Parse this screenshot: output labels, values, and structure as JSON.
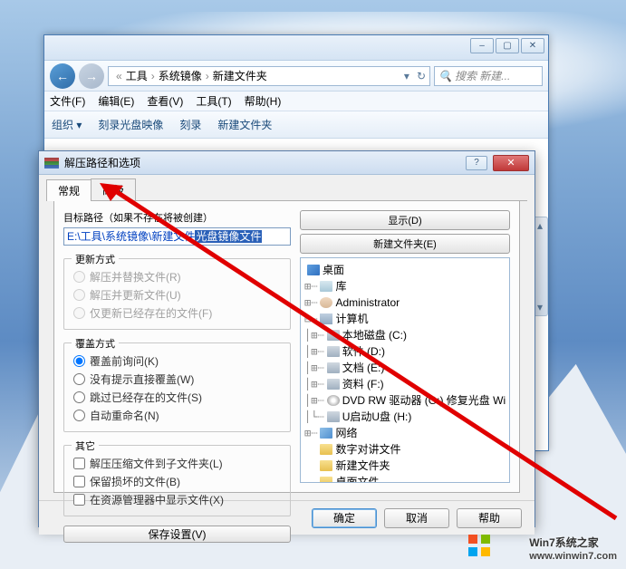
{
  "explorer": {
    "breadcrumb": [
      "工具",
      "系统镜像",
      "新建文件夹"
    ],
    "search_placeholder": "搜索 新建...",
    "menu": [
      "文件(F)",
      "编辑(E)",
      "查看(V)",
      "工具(T)",
      "帮助(H)"
    ],
    "toolbar": [
      "组织 ▾",
      "刻录光盘映像",
      "刻录",
      "新建文件夹"
    ],
    "winbtns": {
      "min": "–",
      "max": "▢",
      "close": "✕"
    }
  },
  "dialog": {
    "title": "解压路径和选项",
    "tabs": {
      "general": "常规",
      "advanced": "高级"
    },
    "path_label": "目标路径（如果不存在将被创建）",
    "path_prefix": "E:\\工具\\系统镜像\\新建文件",
    "path_sel": "光盘镜像文件",
    "update": {
      "legend": "更新方式",
      "o1": "解压并替换文件(R)",
      "o2": "解压并更新文件(U)",
      "o3": "仅更新已经存在的文件(F)"
    },
    "overwrite": {
      "legend": "覆盖方式",
      "o1": "覆盖前询问(K)",
      "o2": "没有提示直接覆盖(W)",
      "o3": "跳过已经存在的文件(S)",
      "o4": "自动重命名(N)"
    },
    "misc": {
      "legend": "其它",
      "o1": "解压压缩文件到子文件夹(L)",
      "o2": "保留损坏的文件(B)",
      "o3": "在资源管理器中显示文件(X)"
    },
    "save_btn": "保存设置(V)",
    "right_btns": {
      "show": "显示(D)",
      "newfolder": "新建文件夹(E)"
    },
    "tree": {
      "desktop": "桌面",
      "lib": "库",
      "user": "Administrator",
      "computer": "计算机",
      "drive_c": "本地磁盘 (C:)",
      "drive_soft": "软件 (D:)",
      "drive_doc": "文档 (E:)",
      "drive_data": "资料 (F:)",
      "dvd": "DVD RW 驱动器 (G:) 修复光盘 Wi",
      "udisk": "U启动U盘 (H:)",
      "network": "网络",
      "f1": "数字对讲文件",
      "f2": "新建文件夹",
      "f3": "桌面文件"
    },
    "buttons": {
      "ok": "确定",
      "cancel": "取消",
      "help": "帮助"
    }
  },
  "watermark": {
    "brand": "Win7系统之家",
    "url": "www.winwin7.com"
  }
}
